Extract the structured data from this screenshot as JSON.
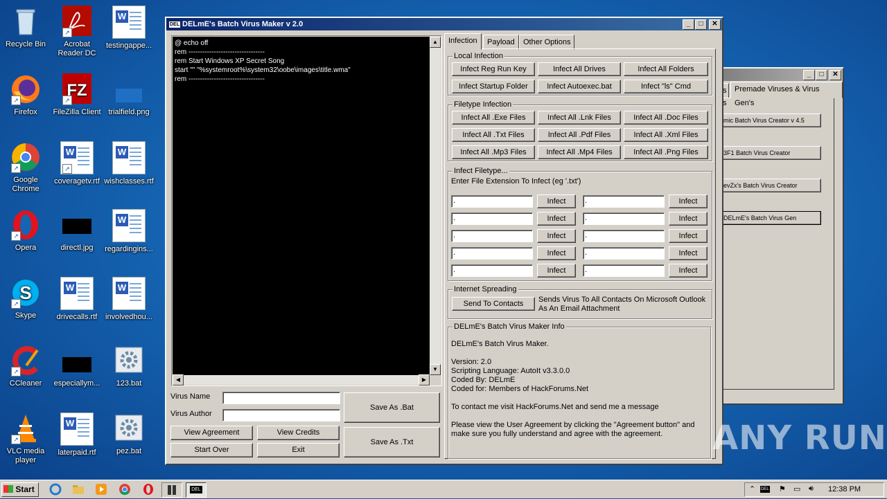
{
  "desktop": {
    "icons": [
      {
        "label": "Recycle Bin"
      },
      {
        "label": "Acrobat Reader DC"
      },
      {
        "label": "testingappe..."
      },
      {
        "label": "Firefox"
      },
      {
        "label": "FileZilla Client"
      },
      {
        "label": "trialfield.png"
      },
      {
        "label": "Google Chrome"
      },
      {
        "label": "coveragetv.rtf"
      },
      {
        "label": "wishclasses.rtf"
      },
      {
        "label": "Opera"
      },
      {
        "label": "directl.jpg"
      },
      {
        "label": "regardingins..."
      },
      {
        "label": "Skype"
      },
      {
        "label": "drivecalls.rtf"
      },
      {
        "label": "involvedhou..."
      },
      {
        "label": "CCleaner"
      },
      {
        "label": "especiallym..."
      },
      {
        "label": "123.bat"
      },
      {
        "label": "VLC media player"
      },
      {
        "label": "laterpaid.rtf"
      },
      {
        "label": "pez.bat"
      }
    ]
  },
  "main_window": {
    "title": "DELmE's Batch Virus Maker v 2.0",
    "title_icon": "DEL",
    "code": "@ echo off\nrem ---------------------------------\nrem Start Windows XP Secret Song\nstart \"\" \"%systemroot%\\system32\\oobe\\images\\title.wma\"\nrem ---------------------------------",
    "virus_name_label": "Virus Name",
    "virus_author_label": "Virus Author",
    "virus_name_value": "",
    "virus_author_value": "",
    "buttons": {
      "view_agreement": "View Agreement",
      "view_credits": "View Credits",
      "start_over": "Start Over",
      "exit": "Exit",
      "save_bat": "Save As .Bat",
      "save_txt": "Save As .Txt"
    },
    "tabs": [
      "Infection",
      "Payload",
      "Other Options"
    ],
    "local_infection": {
      "title": "Local Infection",
      "buttons": [
        "Infect Reg Run Key",
        "Infect All Drives",
        "Infect All Folders",
        "Infect Startup Folder",
        "Infect Autoexec.bat",
        "Infect \"ls\" Cmd"
      ]
    },
    "filetype_infection": {
      "title": "Filetype Infection",
      "buttons": [
        "Infect All .Exe Files",
        "Infect All .Lnk Files",
        "Infect All .Doc Files",
        "Infect All .Txt Files",
        "Infect All .Pdf Files",
        "Infect All .Xml Files",
        "Infect All .Mp3 Files",
        "Infect All .Mp4 Files",
        "Infect All .Png Files"
      ]
    },
    "infect_filetype": {
      "title": "Infect Filetype...",
      "instruction": "Enter File Extension To Infect (eg '.txt')",
      "field_value": ".",
      "infect_label": "Infect"
    },
    "internet_spreading": {
      "title": "Internet Spreading",
      "button": "Send To Contacts",
      "description": "Sends Virus To All Contacts On Microsoft Outlook As An Email Attachment"
    },
    "info": {
      "title": "DELmE's Batch Virus Maker Info",
      "line1": "DELmE's Batch Virus Maker.",
      "version": "Version: 2.0",
      "language": "Scripting Language: AutoIt v3.3.0.0",
      "coded_by": "Coded By: DELmE",
      "coded_for": "Coded for: Members of HackForums.Net",
      "contact": "To contact me visit HackForums.Net and send me a message",
      "agreement": "Please view the User Agreement by clicking the \"Agreement button\" and make sure you fully understand and agree with the agreement."
    }
  },
  "back_window": {
    "tab_fragment": "s",
    "tab_label": "Premade Viruses & Virus Gen's",
    "group_fragment": "s",
    "buttons": [
      "mic Batch Virus Creator v 4.5",
      "3F1 Batch Virus Creator",
      "evZx's Batch Virus Creator",
      "DELmE's Batch Virus Gen"
    ]
  },
  "taskbar": {
    "start_label": "Start",
    "task_label": "DEL",
    "clock": "12:38 PM"
  },
  "watermark": "ANY RUN",
  "colors": {
    "title_active": "#0a246a",
    "face": "#d4d0c8"
  }
}
